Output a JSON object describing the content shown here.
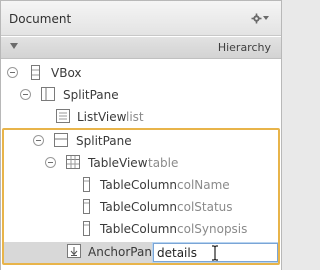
{
  "panel": {
    "title": "Document",
    "mode": "Hierarchy"
  },
  "tree": {
    "nodes": [
      {
        "label": "VBox",
        "fx": ""
      },
      {
        "label": "SplitPane",
        "fx": ""
      },
      {
        "label": "ListView",
        "fx": "list"
      },
      {
        "label": "SplitPane",
        "fx": ""
      },
      {
        "label": "TableView",
        "fx": "table"
      },
      {
        "label": "TableColumn",
        "fx": "colName"
      },
      {
        "label": "TableColumn",
        "fx": "colStatus"
      },
      {
        "label": "TableColumn",
        "fx": "colSynopsis"
      },
      {
        "label": "AnchorPane",
        "fx": ""
      }
    ],
    "edit_value": "details"
  },
  "colors": {
    "highlight": "#e8b44a",
    "selection": "#d8d8d8",
    "edit_border": "#7aa5d6"
  }
}
